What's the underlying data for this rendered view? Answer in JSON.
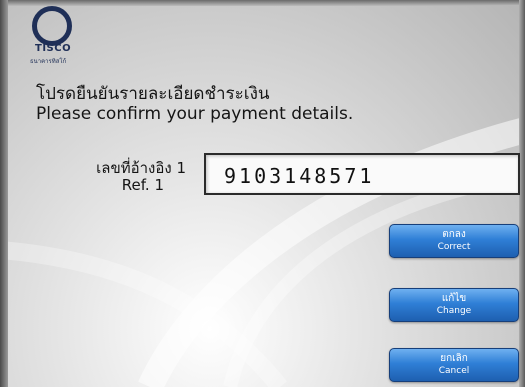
{
  "logo": {
    "brand": "TISCO",
    "subtitle": "ธนาคารทิสโก้"
  },
  "heading": {
    "thai": "โปรดยืนยันรายละเอียดชำระเงิน",
    "english": "Please confirm your payment details."
  },
  "reference": {
    "label_thai": "เลขที่อ้างอิง 1",
    "label_english": "Ref. 1",
    "value": "9103148571"
  },
  "buttons": {
    "correct": {
      "thai": "ตกลง",
      "english": "Correct"
    },
    "change": {
      "thai": "แก้ไข",
      "english": "Change"
    },
    "cancel": {
      "thai": "ยกเลิก",
      "english": "Cancel"
    }
  },
  "colors": {
    "brand": "#1f2f57",
    "button_top": "#6fb0f0",
    "button_bottom": "#1e5fb0"
  }
}
